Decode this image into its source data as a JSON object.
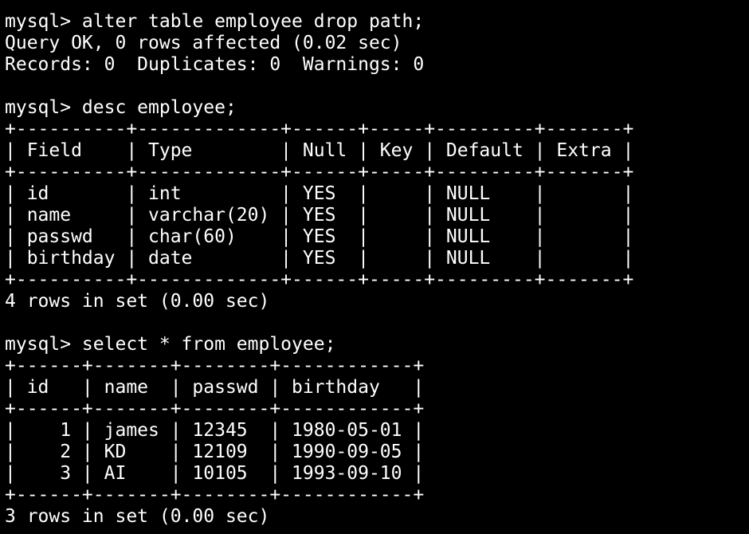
{
  "terminal": {
    "lines": [
      "mysql> alter table employee drop path;",
      "Query OK, 0 rows affected (0.02 sec)",
      "Records: 0  Duplicates: 0  Warnings: 0",
      "",
      "mysql> desc employee;",
      "+----------+-------------+------+-----+---------+-------+",
      "| Field    | Type        | Null | Key | Default | Extra |",
      "+----------+-------------+------+-----+---------+-------+",
      "| id       | int         | YES  |     | NULL    |       |",
      "| name     | varchar(20) | YES  |     | NULL    |       |",
      "| passwd   | char(60)    | YES  |     | NULL    |       |",
      "| birthday | date        | YES  |     | NULL    |       |",
      "+----------+-------------+------+-----+---------+-------+",
      "4 rows in set (0.00 sec)",
      "",
      "mysql> select * from employee;",
      "+------+-------+--------+------------+",
      "| id   | name  | passwd | birthday   |",
      "+------+-------+--------+------------+",
      "|    1 | james | 12345  | 1980-05-01 |",
      "|    2 | KD    | 12109  | 1990-09-05 |",
      "|    3 | AI    | 10105  | 1993-09-10 |",
      "+------+-------+--------+------------+",
      "3 rows in set (0.00 sec)"
    ]
  }
}
